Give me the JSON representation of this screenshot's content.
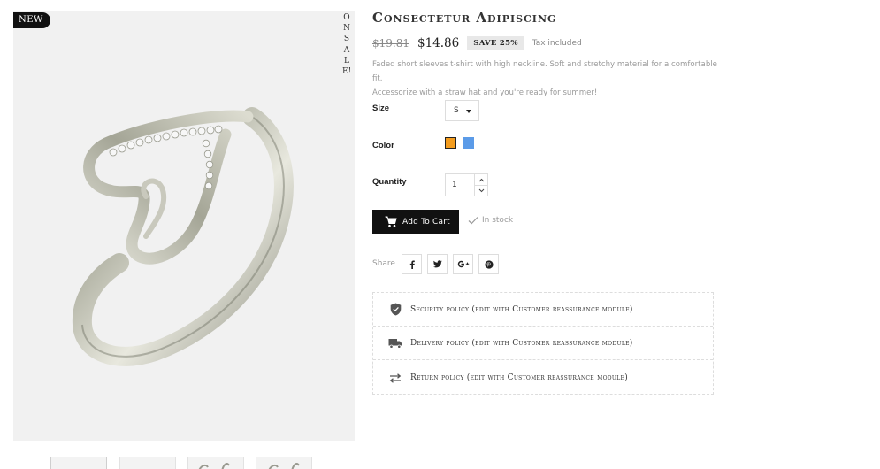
{
  "product": {
    "title": "Consectetur Adipiscing",
    "badge_new": "NEW",
    "badge_on_sale": "ONSALE!",
    "old_price": "$19.81",
    "price": "$14.86",
    "discount": "SAVE 25%",
    "tax_note": "Tax included",
    "description_line1": "Faded short sleeves t-shirt with high neckline. Soft and stretchy material for a comfortable fit.",
    "description_line2": "Accessorize with a straw hat and you're ready for summer!"
  },
  "options": {
    "size_label": "Size",
    "size_value": "S",
    "color_label": "Color",
    "colors": [
      "#f39c1e",
      "#5b9be8"
    ],
    "quantity_label": "Quantity",
    "quantity_value": "1"
  },
  "actions": {
    "add_to_cart": "Add To Cart",
    "stock_status": "In stock",
    "share_label": "Share",
    "social": [
      "facebook-icon",
      "twitter-icon",
      "google-plus-icon",
      "pinterest-icon"
    ]
  },
  "reassurance": [
    {
      "icon": "shield-icon",
      "text": "Security policy (edit with Customer reassurance module)"
    },
    {
      "icon": "truck-icon",
      "text": "Delivery policy (edit with Customer reassurance module)"
    },
    {
      "icon": "exchange-arrows-icon",
      "text": "Return policy (edit with Customer reassurance module)"
    }
  ]
}
